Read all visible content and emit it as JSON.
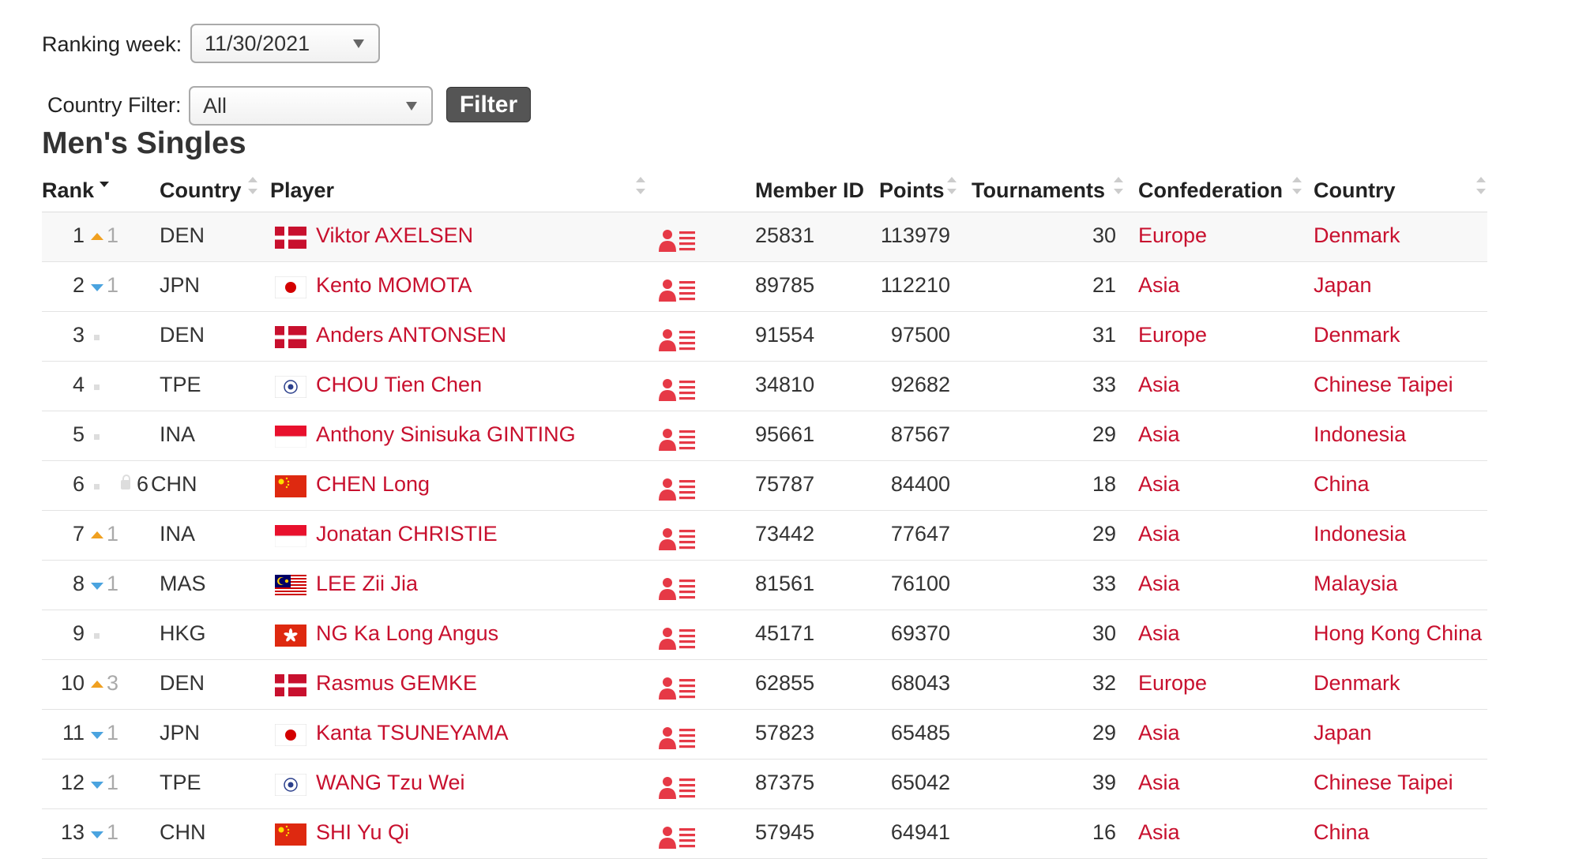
{
  "controls": {
    "ranking_week_label": "Ranking week:",
    "ranking_week_value": "11/30/2021",
    "country_filter_label": "Country Filter:",
    "country_filter_value": "All",
    "filter_button": "Filter"
  },
  "title": "Men's Singles",
  "table": {
    "headers": {
      "rank": "Rank",
      "country_code": "Country",
      "player": "Player",
      "member_id": "Member ID",
      "points": "Points",
      "tournaments": "Tournaments",
      "confederation": "Confederation",
      "country": "Country"
    },
    "rows": [
      {
        "rank": "1",
        "move": "up",
        "move_val": "1",
        "protected": "",
        "code": "DEN",
        "flag": "den",
        "player": "Viktor AXELSEN",
        "member_id": "25831",
        "points": "113979",
        "tournaments": "30",
        "confederation": "Europe",
        "country": "Denmark"
      },
      {
        "rank": "2",
        "move": "down",
        "move_val": "1",
        "protected": "",
        "code": "JPN",
        "flag": "jpn",
        "player": "Kento MOMOTA",
        "member_id": "89785",
        "points": "112210",
        "tournaments": "21",
        "confederation": "Asia",
        "country": "Japan"
      },
      {
        "rank": "3",
        "move": "none",
        "move_val": "",
        "protected": "",
        "code": "DEN",
        "flag": "den",
        "player": "Anders ANTONSEN",
        "member_id": "91554",
        "points": "97500",
        "tournaments": "31",
        "confederation": "Europe",
        "country": "Denmark"
      },
      {
        "rank": "4",
        "move": "none",
        "move_val": "",
        "protected": "",
        "code": "TPE",
        "flag": "tpe",
        "player": "CHOU Tien Chen",
        "member_id": "34810",
        "points": "92682",
        "tournaments": "33",
        "confederation": "Asia",
        "country": "Chinese Taipei"
      },
      {
        "rank": "5",
        "move": "none",
        "move_val": "",
        "protected": "",
        "code": "INA",
        "flag": "ina",
        "player": "Anthony Sinisuka GINTING",
        "member_id": "95661",
        "points": "87567",
        "tournaments": "29",
        "confederation": "Asia",
        "country": "Indonesia"
      },
      {
        "rank": "6",
        "move": "none",
        "move_val": "",
        "protected": "6",
        "code": "CHN",
        "flag": "chn",
        "player": "CHEN Long",
        "member_id": "75787",
        "points": "84400",
        "tournaments": "18",
        "confederation": "Asia",
        "country": "China"
      },
      {
        "rank": "7",
        "move": "up",
        "move_val": "1",
        "protected": "",
        "code": "INA",
        "flag": "ina",
        "player": "Jonatan CHRISTIE",
        "member_id": "73442",
        "points": "77647",
        "tournaments": "29",
        "confederation": "Asia",
        "country": "Indonesia"
      },
      {
        "rank": "8",
        "move": "down",
        "move_val": "1",
        "protected": "",
        "code": "MAS",
        "flag": "mas",
        "player": "LEE Zii Jia",
        "member_id": "81561",
        "points": "76100",
        "tournaments": "33",
        "confederation": "Asia",
        "country": "Malaysia"
      },
      {
        "rank": "9",
        "move": "none",
        "move_val": "",
        "protected": "",
        "code": "HKG",
        "flag": "hkg",
        "player": "NG Ka Long Angus",
        "member_id": "45171",
        "points": "69370",
        "tournaments": "30",
        "confederation": "Asia",
        "country": "Hong Kong China"
      },
      {
        "rank": "10",
        "move": "up",
        "move_val": "3",
        "protected": "",
        "code": "DEN",
        "flag": "den",
        "player": "Rasmus GEMKE",
        "member_id": "62855",
        "points": "68043",
        "tournaments": "32",
        "confederation": "Europe",
        "country": "Denmark"
      },
      {
        "rank": "11",
        "move": "down",
        "move_val": "1",
        "protected": "",
        "code": "JPN",
        "flag": "jpn",
        "player": "Kanta TSUNEYAMA",
        "member_id": "57823",
        "points": "65485",
        "tournaments": "29",
        "confederation": "Asia",
        "country": "Japan"
      },
      {
        "rank": "12",
        "move": "down",
        "move_val": "1",
        "protected": "",
        "code": "TPE",
        "flag": "tpe",
        "player": "WANG Tzu Wei",
        "member_id": "87375",
        "points": "65042",
        "tournaments": "39",
        "confederation": "Asia",
        "country": "Chinese Taipei"
      },
      {
        "rank": "13",
        "move": "down",
        "move_val": "1",
        "protected": "",
        "code": "CHN",
        "flag": "chn",
        "player": "SHI Yu Qi",
        "member_id": "57945",
        "points": "64941",
        "tournaments": "16",
        "confederation": "Asia",
        "country": "China"
      }
    ]
  },
  "colors": {
    "link": "#c8102e",
    "move_up": "#f0a020",
    "move_down": "#4aa3df",
    "button_bg": "#555555"
  }
}
